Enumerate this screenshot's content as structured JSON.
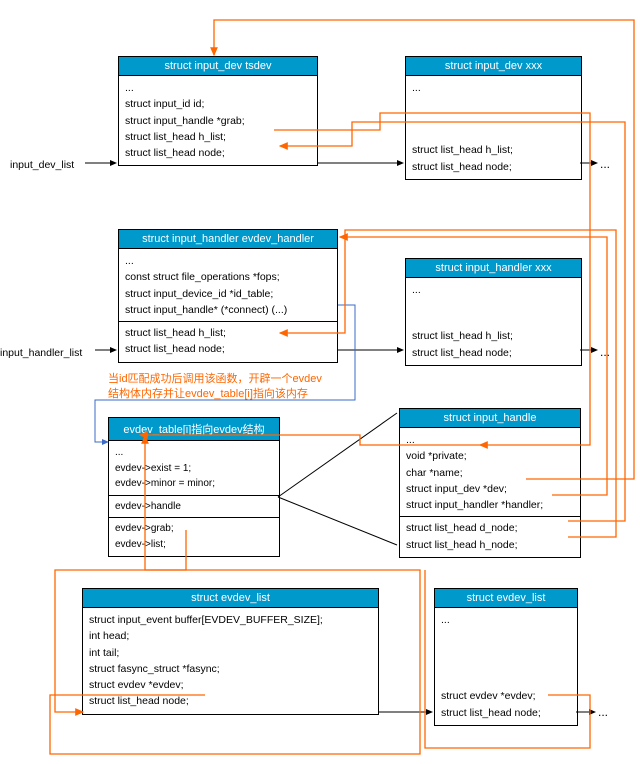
{
  "labels": {
    "dev_list": "input_dev_list",
    "handler_list": "input_handler_list"
  },
  "boxes": {
    "tsdev": {
      "title": "struct  input_dev  tsdev",
      "lines": [
        "...",
        "struct  input_id  id;",
        "struct input_handle *grab;",
        "struct list_head    h_list;",
        "struct list_head    node;"
      ]
    },
    "dev_xxx": {
      "title": "struct  input_dev    xxx",
      "lines1": [
        "..."
      ],
      "lines2": [
        "struct list_head    h_list;",
        "struct list_head    node;"
      ]
    },
    "evdev_handler": {
      "title": "struct input_handler evdev_handler",
      "lines1": [
        "...",
        "const struct file_operations *fops;",
        "struct input_device_id *id_table;",
        "struct input_handle* (*connect) (...)"
      ],
      "lines2": [
        "struct list_head    h_list;",
        "struct list_head    node;"
      ]
    },
    "handler_xxx": {
      "title": "struct  input_handler xxx",
      "lines1": [
        "..."
      ],
      "lines2": [
        "struct list_head    h_list;",
        "struct list_head    node;"
      ]
    },
    "evdev_table": {
      "title": "evdev_table[i]指向evdev结构",
      "lines1": [
        "...",
        "evdev->exist = 1;",
        "evdev->minor = minor;"
      ],
      "lines2": [
        "evdev->handle"
      ],
      "lines3": [
        "evdev->grab;",
        "evdev->list;"
      ]
    },
    "handle": {
      "title": "struct input_handle",
      "lines1": [
        "...",
        "void *private;",
        "char *name;",
        "struct input_dev *dev;",
        "struct input_handler *handler;"
      ],
      "lines2": [
        "struct list_head    d_node;",
        "struct list_head    h_node;"
      ]
    },
    "evdev_list1": {
      "title": "struct evdev_list",
      "lines": [
        "struct input_event buffer[EVDEV_BUFFER_SIZE];",
        "int head;",
        "int tail;",
        "struct fasync_struct *fasync;",
        "struct evdev *evdev;",
        "struct list_head node;"
      ]
    },
    "evdev_list2": {
      "title": "struct evdev_list",
      "lines1": [
        "..."
      ],
      "lines2": [
        "struct evdev *evdev;",
        "struct list_head node;"
      ]
    }
  },
  "note": {
    "l1": "当id匹配成功后调用该函数，开辟一个evdev",
    "l2": "结构体内存并让evdev_table[i]指向该内存"
  },
  "colors": {
    "orange": "#ff6600",
    "black": "#000000",
    "blue": "#3b6bc7"
  }
}
